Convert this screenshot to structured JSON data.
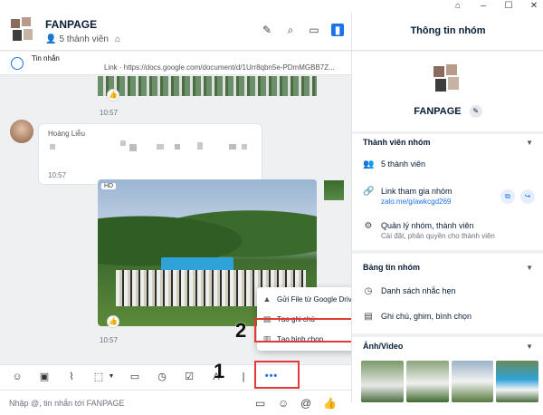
{
  "window": {
    "pin_icon": "pin-icon",
    "min_icon": "minimize-icon",
    "max_icon": "maximize-icon",
    "close_icon": "close-icon"
  },
  "chat": {
    "name": "FANPAGE",
    "members": "5 thành viên",
    "pinned": {
      "title": "Tin nhắn",
      "link_text": "Link · https://docs.google.com/document/d/1Urr8qbn5e-PDmMGBB7Z..."
    },
    "messages": [
      {
        "type": "image",
        "time": "10:57"
      },
      {
        "type": "text",
        "sender": "Hoàng Liễu",
        "time": "10:57"
      },
      {
        "type": "image",
        "badge": "HD",
        "time": "10:57"
      }
    ],
    "input_placeholder": "Nhập @, tin nhắn tới FANPAGE"
  },
  "menu": {
    "items": [
      {
        "label": "Gửi File từ Google Drive",
        "icon": "google-drive-icon"
      },
      {
        "label": "Tạo ghi chú",
        "icon": "note-icon"
      },
      {
        "label": "Tạo bình chọn",
        "icon": "poll-icon"
      }
    ]
  },
  "annotations": {
    "step1": "1",
    "step2": "2"
  },
  "info": {
    "title": "Thông tin nhóm",
    "group_name": "FANPAGE",
    "members_section": {
      "title": "Thành viên nhóm",
      "count": "5 thành viên",
      "join_link_label": "Link tham gia nhóm",
      "join_link": "zalo.me/g/awkcgd269",
      "manage_label": "Quản lý nhóm, thành viên",
      "manage_sub": "Cài đặt, phân quyền cho thành viên"
    },
    "board_section": {
      "title": "Bảng tin nhóm",
      "reminders": "Danh sách nhắc hẹn",
      "notes": "Ghi chú, ghim, bình chọn"
    },
    "media_section": {
      "title": "Ảnh/Video"
    }
  },
  "colors": {
    "accent": "#1a73e8",
    "highlight": "#e53935"
  }
}
